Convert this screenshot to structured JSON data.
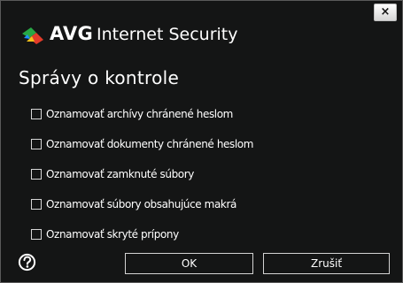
{
  "window": {
    "brand": "AVG",
    "product": "Internet Security",
    "close_label": "×"
  },
  "section": {
    "title": "Správy o kontrole"
  },
  "options": [
    {
      "label": "Oznamovať archívy chránené heslom",
      "checked": false
    },
    {
      "label": "Oznamovať dokumenty chránené heslom",
      "checked": false
    },
    {
      "label": "Oznamovať zamknuté súbory",
      "checked": false
    },
    {
      "label": "Oznamovať súbory obsahujúce makrá",
      "checked": false
    },
    {
      "label": "Oznamovať skryté prípony",
      "checked": false
    }
  ],
  "buttons": {
    "ok_label": "OK",
    "cancel_label": "Zrušiť"
  },
  "icons": {
    "logo": "avg-logo-icon",
    "help": "help-icon",
    "close": "close-icon"
  },
  "colors": {
    "background": "#141515",
    "text": "#ffffff",
    "logo_red": "#e23b2a",
    "logo_green": "#28a745",
    "logo_yellow": "#f3c21a",
    "logo_blue": "#1e90ff"
  }
}
